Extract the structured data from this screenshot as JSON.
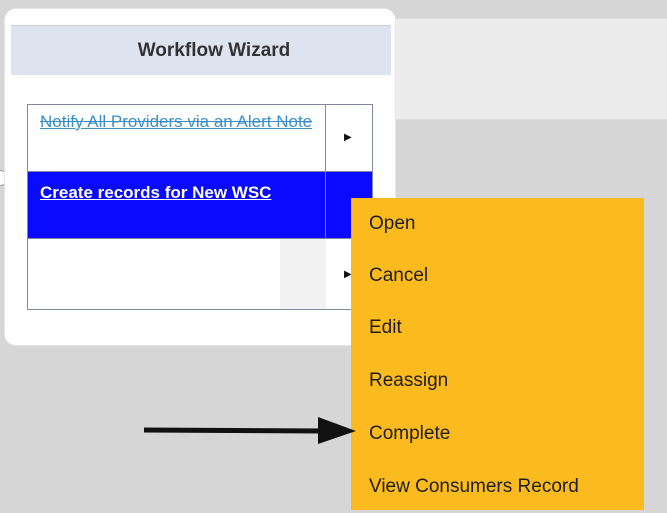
{
  "wizard": {
    "title": "Workflow Wizard",
    "tasks": [
      {
        "label": "Notify All Providers via an Alert Note",
        "state": "completed"
      },
      {
        "label": "Create records for New WSC",
        "state": "selected"
      },
      {
        "label": "",
        "state": "empty"
      }
    ],
    "row_arrow_icon": "triangle-right-icon"
  },
  "context_menu": {
    "items": [
      "Open",
      "Cancel",
      "Edit",
      "Reassign",
      "Complete",
      "View Consumers Record"
    ],
    "background_color": "#fbba1e"
  },
  "annotation": {
    "pointer_icon": "arrow-right-icon",
    "points_to": "Complete"
  },
  "colors": {
    "selected_row": "#0a0aff",
    "completed_link": "#3b8fc6",
    "header_bg": "#dde3ef"
  }
}
